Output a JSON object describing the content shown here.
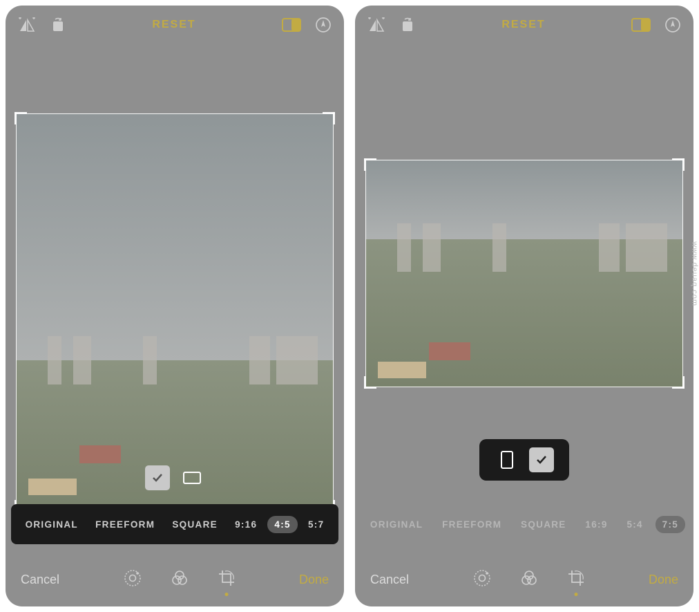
{
  "watermark": "www.deuaq.com",
  "left": {
    "reset_label": "RESET",
    "aspect_ratios": [
      {
        "label": "ORIGINAL",
        "selected": false
      },
      {
        "label": "FREEFORM",
        "selected": false
      },
      {
        "label": "SQUARE",
        "selected": false
      },
      {
        "label": "9:16",
        "selected": false
      },
      {
        "label": "4:5",
        "selected": true
      },
      {
        "label": "5:7",
        "selected": false
      }
    ],
    "orientation": {
      "portrait_selected": true,
      "landscape_selected": false
    },
    "cancel_label": "Cancel",
    "done_label": "Done"
  },
  "right": {
    "reset_label": "RESET",
    "aspect_ratios": [
      {
        "label": "ORIGINAL",
        "selected": false
      },
      {
        "label": "FREEFORM",
        "selected": false
      },
      {
        "label": "SQUARE",
        "selected": false
      },
      {
        "label": "16:9",
        "selected": false
      },
      {
        "label": "5:4",
        "selected": false
      },
      {
        "label": "7:5",
        "selected": true
      }
    ],
    "orientation": {
      "portrait_selected": false,
      "landscape_selected": true
    },
    "cancel_label": "Cancel",
    "done_label": "Done"
  }
}
